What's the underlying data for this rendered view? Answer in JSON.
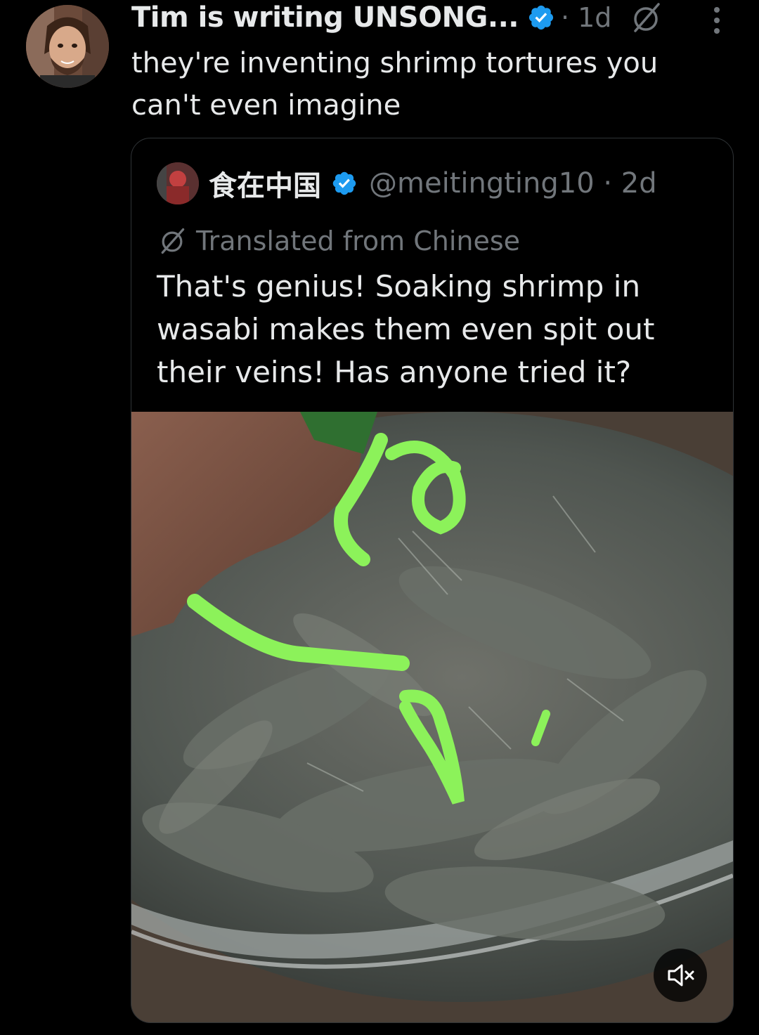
{
  "tweet": {
    "author_name": "Tim is writing UNSONG...",
    "meta": "· 1d",
    "text": "they're inventing shrimp tortures you can't even imagine"
  },
  "quote": {
    "author_name": "食在中国",
    "handle_and_time": "@meitingting10 · 2d",
    "translated_label": "Translated from Chinese",
    "text": "That's genius! Soaking shrimp in wasabi makes them even spit out their veins! Has anyone tried it?"
  },
  "icons": {
    "verified": "verified-badge-icon",
    "translate": "translate-icon",
    "more": "more-options-icon",
    "mute": "muted-speaker-icon"
  },
  "colors": {
    "background": "#000000",
    "text_primary": "#e7e9ea",
    "text_secondary": "#71767b",
    "verified_blue": "#1d9bf0",
    "card_border": "#2f3336"
  }
}
